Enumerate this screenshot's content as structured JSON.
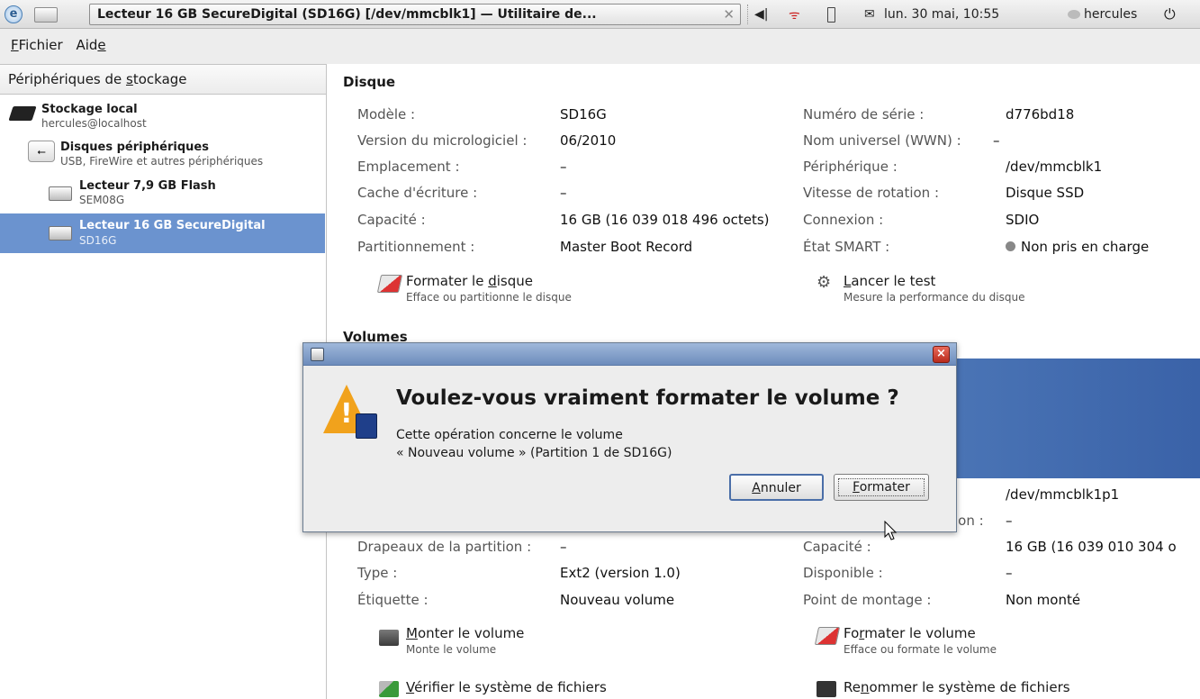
{
  "topbar": {
    "window_title": "Lecteur 16 GB SecureDigital (SD16G) [/dev/mmcblk1] — Utilitaire de...",
    "close_glyph": "✕",
    "datetime": "lun. 30 mai, 10:55",
    "user": "hercules"
  },
  "menubar": {
    "file": "Fichier",
    "help_pre": "Aid",
    "help_u": "e"
  },
  "sidebar": {
    "header_pre": "Périphériques de ",
    "header_u": "s",
    "header_post": "tockage",
    "items": [
      {
        "title": "Stockage local",
        "subtitle": "hercules@localhost"
      },
      {
        "title": "Disques périphériques",
        "subtitle": "USB, FireWire et autres périphériques"
      },
      {
        "title": "Lecteur 7,9 GB Flash",
        "subtitle": "SEM08G"
      },
      {
        "title": "Lecteur 16 GB SecureDigital",
        "subtitle": "SD16G",
        "selected": true
      }
    ]
  },
  "disk": {
    "title": "Disque",
    "left": [
      {
        "label": "Modèle :",
        "value": "SD16G"
      },
      {
        "label": "Version du micrologiciel :",
        "value": "06/2010"
      },
      {
        "label": "Emplacement :",
        "value": "–"
      },
      {
        "label": "Cache d'écriture :",
        "value": "–"
      },
      {
        "label": "Capacité :",
        "value": "16 GB (16 039 018 496 octets)"
      },
      {
        "label": "Partitionnement :",
        "value": "Master Boot Record"
      }
    ],
    "right": [
      {
        "label": "Numéro de série :",
        "value": "d776bd18"
      },
      {
        "label": "Nom universel (WWN) :",
        "value": "–"
      },
      {
        "label": "Périphérique :",
        "value": "/dev/mmcblk1"
      },
      {
        "label": "Vitesse de rotation :",
        "value": "Disque SSD"
      },
      {
        "label": "Connexion :",
        "value": "SDIO"
      },
      {
        "label": "État SMART :",
        "value": "Non pris en charge"
      }
    ],
    "actions": {
      "format_pre": "Formater le ",
      "format_u": "d",
      "format_post": "isque",
      "format_desc": "Efface ou partitionne le disque",
      "bench_u": "L",
      "bench_post": "ancer le test",
      "bench_desc": "Mesure la performance du disque"
    }
  },
  "volumes": {
    "title": "Volumes",
    "device_value": "/dev/mmcblk1p1",
    "partial_label": "ion :",
    "partial_value": "–",
    "left": [
      {
        "label": "Drapeaux de la partition :",
        "value": "–"
      },
      {
        "label": "Type :",
        "value": "Ext2 (version 1.0)"
      },
      {
        "label": "Étiquette :",
        "value": "Nouveau volume"
      }
    ],
    "right": [
      {
        "label": "Capacité :",
        "value": "16 GB (16 039 010 304 o"
      },
      {
        "label": "Disponible :",
        "value": "–"
      },
      {
        "label": "Point de montage :",
        "value": "Non monté"
      }
    ],
    "actions": {
      "mount_u": "M",
      "mount_post": "onter le volume",
      "mount_desc": "Monte le volume",
      "format_pre": "Fo",
      "format_u": "r",
      "format_post": "mater le volume",
      "format_desc": "Efface ou formate le volume",
      "check_u": "V",
      "check_post": "érifier le système de fichiers",
      "rename_pre": "Re",
      "rename_u": "n",
      "rename_post": "ommer le système de fichiers"
    }
  },
  "dialog": {
    "title": "Voulez-vous vraiment formater le volume ?",
    "line1": "Cette opération concerne le volume",
    "line2": "« Nouveau volume » (Partition 1 de SD16G)",
    "cancel_u": "A",
    "cancel_post": "nnuler",
    "ok_u": "F",
    "ok_post": "ormater",
    "close_glyph": "×"
  }
}
